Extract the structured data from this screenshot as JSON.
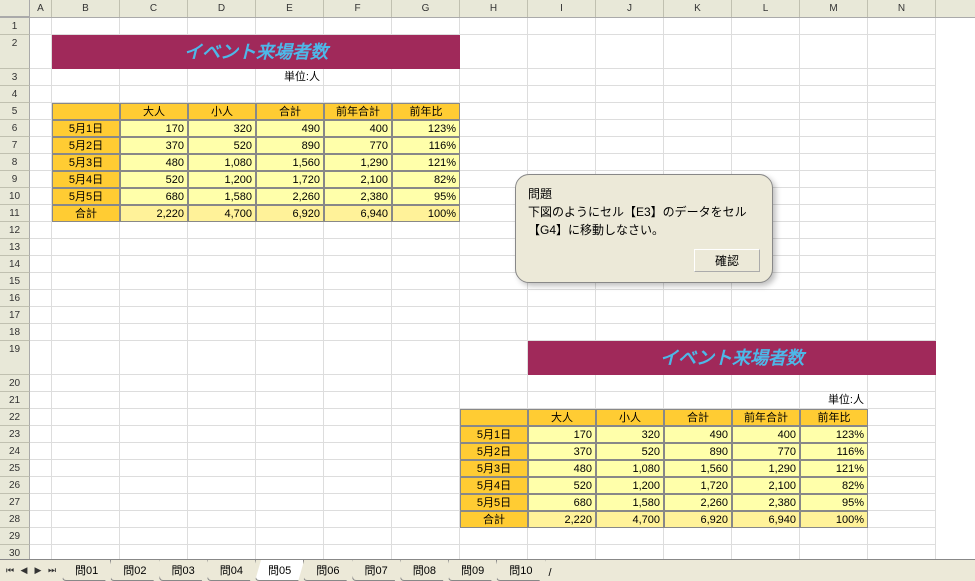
{
  "title": "イベント来場者数",
  "unit_label": "単位:人",
  "headers": [
    "大人",
    "小人",
    "合計",
    "前年合計",
    "前年比"
  ],
  "rows": [
    {
      "date": "5月1日",
      "adult": "170",
      "child": "320",
      "total": "490",
      "prev": "400",
      "pct": "123%"
    },
    {
      "date": "5月2日",
      "adult": "370",
      "child": "520",
      "total": "890",
      "prev": "770",
      "pct": "116%"
    },
    {
      "date": "5月3日",
      "adult": "480",
      "child": "1,080",
      "total": "1,560",
      "prev": "1,290",
      "pct": "121%"
    },
    {
      "date": "5月4日",
      "adult": "520",
      "child": "1,200",
      "total": "1,720",
      "prev": "2,100",
      "pct": "82%"
    },
    {
      "date": "5月5日",
      "adult": "680",
      "child": "1,580",
      "total": "2,260",
      "prev": "2,380",
      "pct": "95%"
    }
  ],
  "total_row": {
    "label": "合計",
    "adult": "2,220",
    "child": "4,700",
    "total": "6,920",
    "prev": "6,940",
    "pct": "100%"
  },
  "dialog": {
    "heading": "問題",
    "line1": "下図のようにセル【E3】のデータをセル",
    "line2": "【G4】に移動しなさい。",
    "ok": "確認"
  },
  "sheet_tabs": [
    "問01",
    "問02",
    "問03",
    "問04",
    "問05",
    "問06",
    "問07",
    "問08",
    "問09",
    "問10"
  ],
  "active_tab": "問05",
  "col_labels": [
    "A",
    "B",
    "C",
    "D",
    "E",
    "F",
    "G",
    "H",
    "I",
    "J",
    "K",
    "L",
    "M",
    "N"
  ],
  "row_count": 30
}
